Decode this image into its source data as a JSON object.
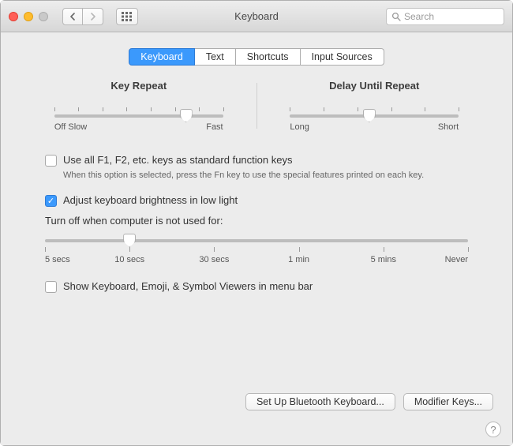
{
  "window": {
    "title": "Keyboard"
  },
  "search": {
    "placeholder": "Search"
  },
  "tabs": [
    "Keyboard",
    "Text",
    "Shortcuts",
    "Input Sources"
  ],
  "active_tab_index": 0,
  "key_repeat": {
    "title": "Key Repeat",
    "left_label": "Off Slow",
    "right_label": "Fast",
    "ticks": 8,
    "value_percent": 78
  },
  "delay_repeat": {
    "title": "Delay Until Repeat",
    "left_label": "Long",
    "right_label": "Short",
    "ticks": 6,
    "value_percent": 47
  },
  "fn_keys": {
    "checked": false,
    "label": "Use all F1, F2, etc. keys as standard function keys",
    "sub": "When this option is selected, press the Fn key to use the special features printed on each key."
  },
  "brightness": {
    "checked": true,
    "label": "Adjust keyboard brightness in low light"
  },
  "timeout": {
    "label": "Turn off when computer is not used for:",
    "stops": [
      {
        "pos": 0,
        "label": "5 secs"
      },
      {
        "pos": 20,
        "label": "10 secs"
      },
      {
        "pos": 40,
        "label": "30 secs"
      },
      {
        "pos": 60,
        "label": "1 min"
      },
      {
        "pos": 80,
        "label": "5 mins"
      },
      {
        "pos": 100,
        "label": "Never"
      }
    ],
    "value_percent": 20
  },
  "show_viewers": {
    "checked": false,
    "label": "Show Keyboard, Emoji, & Symbol Viewers in menu bar"
  },
  "buttons": {
    "bluetooth": "Set Up Bluetooth Keyboard...",
    "modifier": "Modifier Keys..."
  }
}
